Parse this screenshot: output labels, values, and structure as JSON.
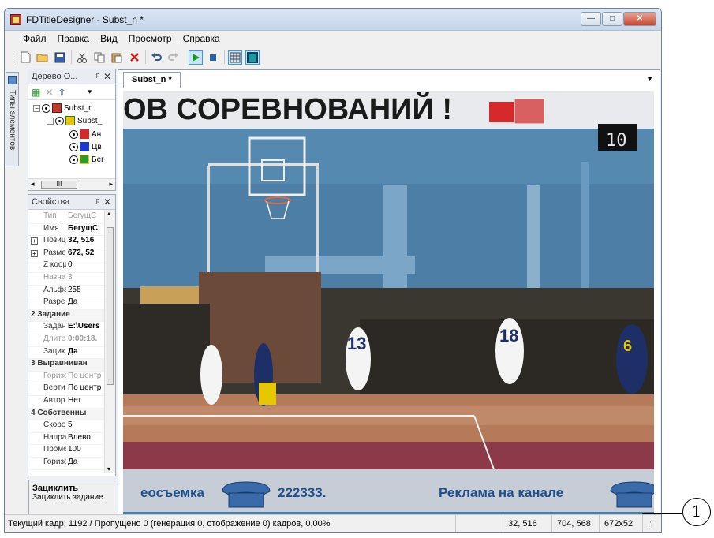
{
  "window": {
    "title": "FDTitleDesigner - Subst_n *",
    "controls": [
      "—",
      "□",
      "✕"
    ]
  },
  "menu": [
    "Файл",
    "Правка",
    "Вид",
    "Просмотр",
    "Справка"
  ],
  "side_tab": {
    "label": "Типы элементов"
  },
  "tree_panel": {
    "title": "Дерево О...",
    "nodes": [
      {
        "label": "Subst_n"
      },
      {
        "label": "Subst_"
      },
      {
        "label": "Ан"
      },
      {
        "label": "Цв"
      },
      {
        "label": "Бег"
      }
    ],
    "scroll_label": "III"
  },
  "props_panel": {
    "title": "Свойства",
    "rows": [
      {
        "name": "Тип",
        "value": "БегущС"
      },
      {
        "name": "Имя",
        "value": "БегущС"
      },
      {
        "name": "Позиц",
        "value": "32, 516"
      },
      {
        "name": "Разме",
        "value": "672, 52"
      },
      {
        "name": "Z коор",
        "value": "0"
      },
      {
        "name": "Назна",
        "value": "3"
      },
      {
        "name": "Альфа",
        "value": "255"
      },
      {
        "name": "Разре",
        "value": "Да"
      },
      {
        "name": "2 Задание"
      },
      {
        "name": "Задан",
        "value": "E:\\Users"
      },
      {
        "name": "Длите",
        "value": "0:00:18."
      },
      {
        "name": "Зацик",
        "value": "Да"
      },
      {
        "name": "3 Выравниван"
      },
      {
        "name": "Горизо",
        "value": "По центр"
      },
      {
        "name": "Верти",
        "value": "По центр"
      },
      {
        "name": "Автор",
        "value": "Нет"
      },
      {
        "name": "4 Собственны"
      },
      {
        "name": "Скоро",
        "value": "5"
      },
      {
        "name": "Напра",
        "value": "Влево"
      },
      {
        "name": "Проме",
        "value": "100"
      },
      {
        "name": "Горизо",
        "value": "Да"
      }
    ]
  },
  "description": {
    "title": "Зациклить",
    "text": "Зациклить задание."
  },
  "document": {
    "tab": "Subst_n *",
    "banner_text": "ОВ СОРЕВНОВАНИЙ !",
    "scoreboard": "10",
    "jersey_numbers": [
      "13",
      "18",
      "6"
    ],
    "ticker": [
      "еосъемка",
      "222333.",
      "Реклама на канале"
    ]
  },
  "status": {
    "frame": "Текущий кадр: 1192 / Пропущено 0 (генерация 0, отображение 0) кадров,  0,00%",
    "pos": "32, 516",
    "end": "704, 568",
    "size": "672x52"
  },
  "callout": "1",
  "colors": {
    "wall": "#4d7fa6",
    "floor": "#b57a5a",
    "ticker_bg": "#c6cdd6",
    "ticker_text": "#1f4f8c",
    "banner_red": "#d62a2a"
  }
}
